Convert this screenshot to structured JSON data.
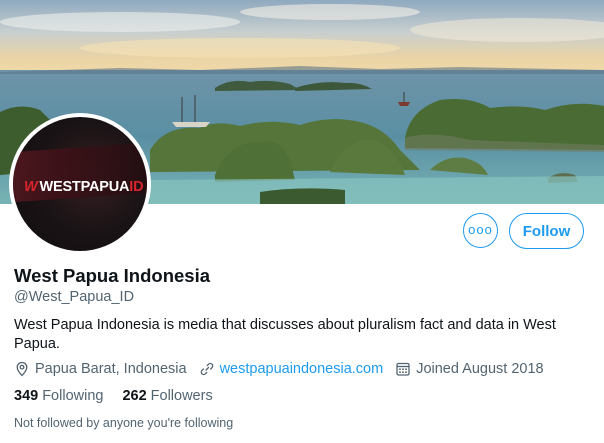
{
  "profile": {
    "display_name": "West Papua Indonesia",
    "handle": "@West_Papua_ID",
    "bio": "West Papua Indonesia is media that discusses about pluralism fact and data in West Papua.",
    "location": "Papua Barat, Indonesia",
    "website": "westpapuaindonesia.com",
    "joined": "Joined August 2018",
    "avatar_text": {
      "mark": "W",
      "name": "WESTPAPUA",
      "suffix": "ID"
    }
  },
  "stats": {
    "following_count": "349",
    "following_label": "Following",
    "followers_count": "262",
    "followers_label": "Followers"
  },
  "actions": {
    "more_label": "ooo",
    "follow_label": "Follow"
  },
  "social_context": "Not followed by anyone you're following",
  "icons": {
    "location": "location-pin-icon",
    "link": "link-icon",
    "calendar": "calendar-icon",
    "more": "more-options-icon"
  },
  "colors": {
    "accent": "#1d9bf0",
    "secondary_text": "#536471",
    "primary_text": "#0f1419",
    "logo_red": "#d6252d"
  }
}
